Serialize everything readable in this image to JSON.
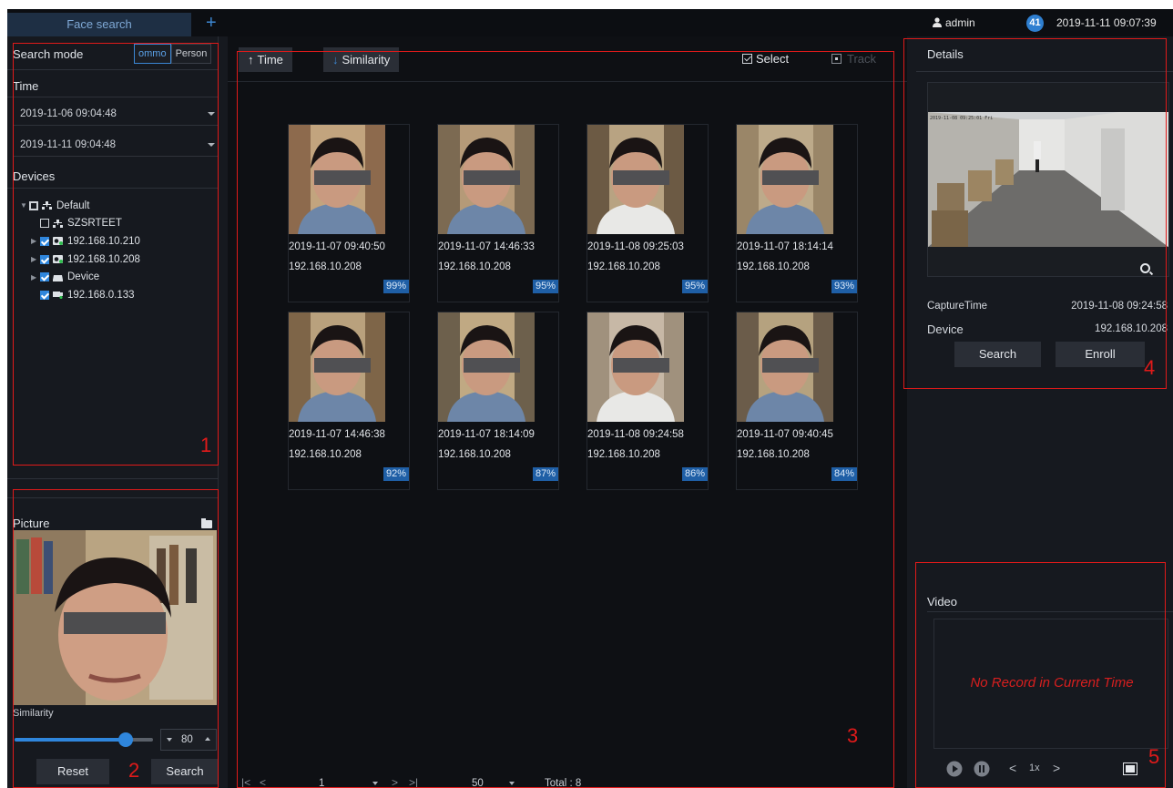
{
  "topbar": {
    "tab_label": "Face search",
    "add_tab": "+",
    "user": "admin",
    "notification_count": "41",
    "datetime": "2019-11-11 09:07:39"
  },
  "left": {
    "search_mode_label": "Search mode",
    "mode_options": [
      "ommo",
      "Person"
    ],
    "mode_selected": "ommo",
    "time_label": "Time",
    "start_time": "2019-11-06 09:04:48",
    "end_time": "2019-11-11 09:04:48",
    "devices_label": "Devices",
    "tree": [
      {
        "label": "Default",
        "state": "partial",
        "icon": "group-icon",
        "level": 0,
        "expanded": true
      },
      {
        "label": "SZSRTEET",
        "state": "unchecked",
        "icon": "group-icon",
        "level": 1
      },
      {
        "label": "192.168.10.210",
        "state": "checked",
        "icon": "camera-icon",
        "level": 1,
        "expandable": true
      },
      {
        "label": "192.168.10.208",
        "state": "checked",
        "icon": "camera-icon",
        "level": 1,
        "expandable": true
      },
      {
        "label": "Device",
        "state": "checked",
        "icon": "nvr-icon",
        "level": 1,
        "expandable": true
      },
      {
        "label": "192.168.0.133",
        "state": "checked",
        "icon": "ipc-icon",
        "level": 1
      }
    ],
    "picture_label": "Picture",
    "similarity_label": "Similarity",
    "similarity_value": "80",
    "similarity_level": 0.8,
    "reset_label": "Reset",
    "search_label": "Search"
  },
  "center": {
    "sort_time": "Time",
    "sort_similarity": "Similarity",
    "select_label": "Select",
    "track_label": "Track",
    "results": [
      {
        "time": "2019-11-07 09:40:50",
        "ip": "192.168.10.208",
        "score": "99%"
      },
      {
        "time": "2019-11-07 14:46:33",
        "ip": "192.168.10.208",
        "score": "95%"
      },
      {
        "time": "2019-11-08 09:25:03",
        "ip": "192.168.10.208",
        "score": "95%"
      },
      {
        "time": "2019-11-07 18:14:14",
        "ip": "192.168.10.208",
        "score": "93%"
      },
      {
        "time": "2019-11-07 14:46:38",
        "ip": "192.168.10.208",
        "score": "92%"
      },
      {
        "time": "2019-11-07 18:14:09",
        "ip": "192.168.10.208",
        "score": "87%"
      },
      {
        "time": "2019-11-08 09:24:58",
        "ip": "192.168.10.208",
        "score": "86%"
      },
      {
        "time": "2019-11-07 09:40:45",
        "ip": "192.168.10.208",
        "score": "84%"
      }
    ],
    "pager": {
      "first": "|<",
      "prev": "<",
      "page": "1",
      "next": ">",
      "last": ">|",
      "per_page": "50",
      "total": "Total : 8"
    }
  },
  "right": {
    "details_label": "Details",
    "frame_timestamp": "2019-11-08 09:25:01 Fri",
    "capture_time_label": "CaptureTime",
    "capture_time": "2019-11-08 09:24:58",
    "device_label": "Device",
    "device_value": "192.168.10.208",
    "search_label": "Search",
    "enroll_label": "Enroll",
    "video_label": "Video",
    "no_record": "No Record in Current Time",
    "speed": "1x"
  },
  "annotations": [
    "1",
    "2",
    "3",
    "4",
    "5"
  ],
  "colors": {
    "accent": "#2f86dc",
    "annotation": "#e01a1a",
    "no_record": "#d81f1f",
    "score_badge": "#1f5fa6"
  }
}
